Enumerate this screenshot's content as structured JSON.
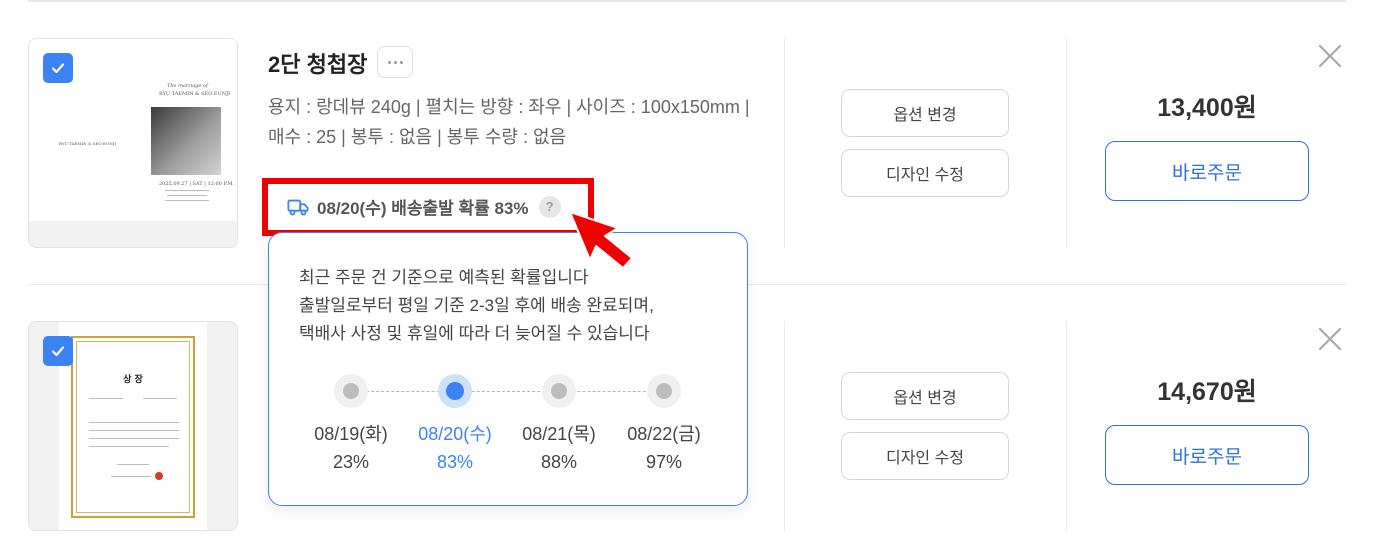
{
  "items": [
    {
      "title": "2단 청첩장",
      "options_text": "용지 : 랑데뷰 240g | 펼치는 방향 : 좌우 | 사이즈 : 100x150mm | 매수 : 25 | 봉투 : 없음 | 봉투 수량 : 없음",
      "shipping_text": "08/20(수) 배송출발 확률 83%",
      "price": "13,400원",
      "thumb_lines": [
        "The marriage of",
        "RYU TAEMIN & SEO EUNJI",
        "RYU TAEMIN & SEO EUNJI",
        "2025.09.27 | SAT | 12:00 P.M."
      ]
    },
    {
      "price": "14,670원",
      "cert_title": "상 장"
    }
  ],
  "buttons": {
    "option_change": "옵션 변경",
    "design_edit": "디자인 수정",
    "order_now": "바로주문",
    "help": "?"
  },
  "tooltip": {
    "line1": "최근 주문 건 기준으로 예측된 확률입니다",
    "line2": "출발일로부터 평일 기준 2-3일 후에 배송 완료되며,",
    "line3": "택배사 사정 및 휴일에 따라 더 늦어질 수 있습니다",
    "timeline": [
      {
        "date": "08/19(화)",
        "prob": "23%",
        "active": false
      },
      {
        "date": "08/20(수)",
        "prob": "83%",
        "active": true
      },
      {
        "date": "08/21(목)",
        "prob": "88%",
        "active": false
      },
      {
        "date": "08/22(금)",
        "prob": "97%",
        "active": false
      }
    ]
  },
  "icons": {
    "checkbox": "check-icon",
    "truck": "truck-icon",
    "close": "close-icon",
    "more": "more-dots-icon",
    "pointer": "red-arrow-cursor-icon"
  },
  "colors": {
    "accent": "#3b82f6",
    "order_button": "#2f6fe0",
    "highlight": "#f00000"
  }
}
